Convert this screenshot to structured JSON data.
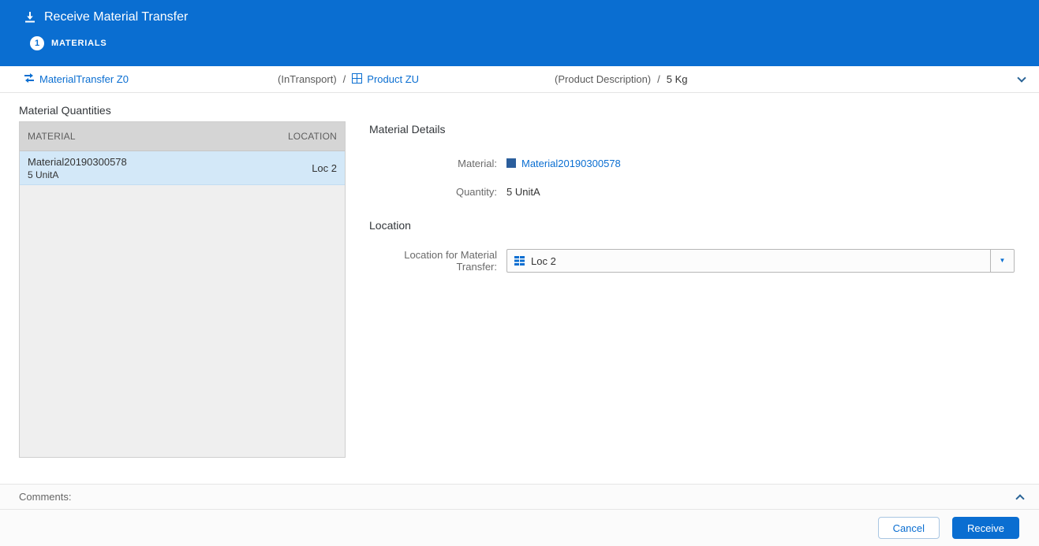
{
  "colors": {
    "primary": "#0a6ed1",
    "header_background": "#0a6ed1",
    "selected_row": "#d3e8f8",
    "table_header_background": "#d5d5d5",
    "material_swatch": "#2b5e9c"
  },
  "header": {
    "title": "Receive Material Transfer",
    "step": {
      "number": "1",
      "label": "MATERIALS"
    }
  },
  "breadcrumb": {
    "transfer_label": "MaterialTransfer Z0",
    "transfer_status": "(InTransport)",
    "separator1": "/",
    "product_label": "Product ZU",
    "product_description": "(Product Description)",
    "separator2": "/",
    "quantity": "5 Kg"
  },
  "material_quantities": {
    "title": "Material Quantities",
    "columns": {
      "material": "MATERIAL",
      "location": "LOCATION"
    },
    "rows": [
      {
        "material": "Material20190300578",
        "quantity": "5 UnitA",
        "location": "Loc 2",
        "selected": true
      }
    ]
  },
  "material_details": {
    "title": "Material Details",
    "material_label": "Material:",
    "material_value": "Material20190300578",
    "quantity_label": "Quantity:",
    "quantity_value": "5 UnitA"
  },
  "location_section": {
    "title": "Location",
    "field_label": "Location for Material Transfer:",
    "field_value": "Loc 2"
  },
  "comments": {
    "label": "Comments:"
  },
  "footer": {
    "cancel": "Cancel",
    "receive": "Receive"
  },
  "icons": {
    "receive": "download-tray-arrow",
    "material_transfer": "transfer-arrows",
    "product": "grid-box",
    "location_grid": "table-grid",
    "dropdown_arrow": "▼"
  }
}
